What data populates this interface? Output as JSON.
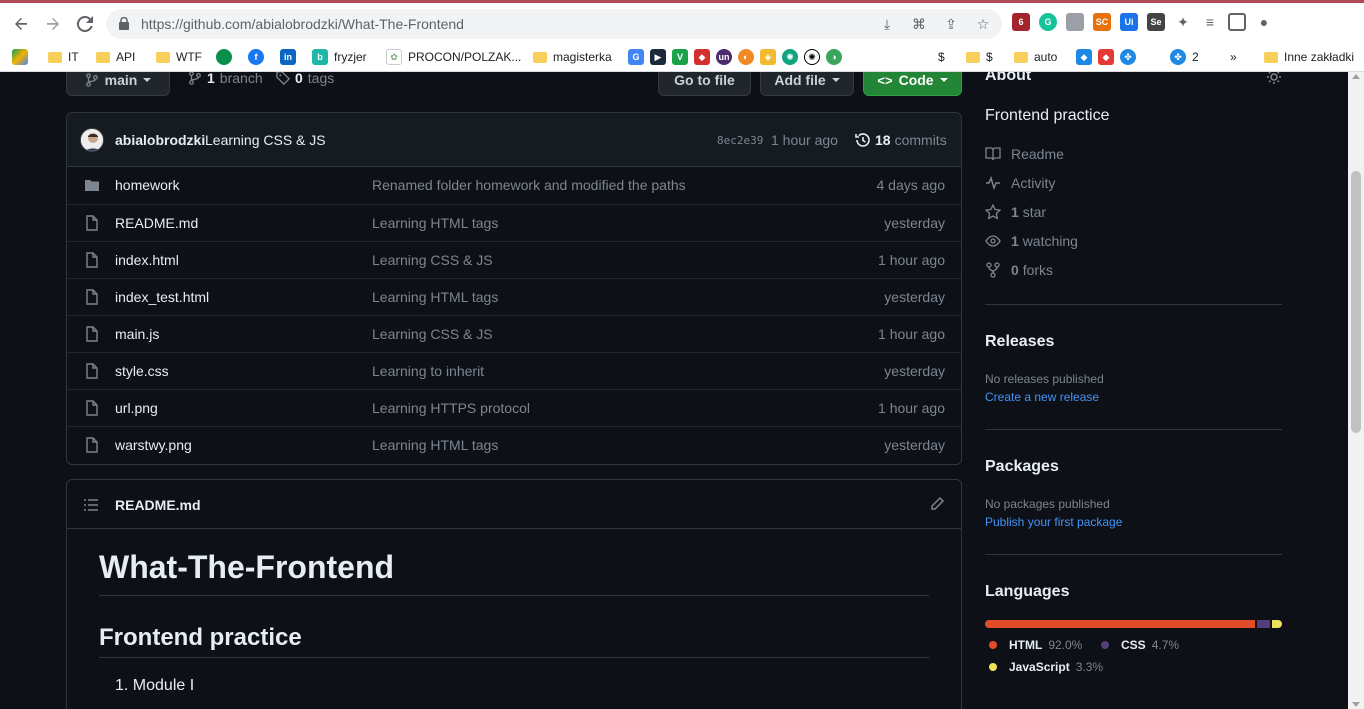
{
  "browser": {
    "url_domain": "https://github.com",
    "url_path": "/abialobrodzki/What-The-Frontend"
  },
  "bookmarks": [
    {
      "label": "",
      "icon": "drive-icon"
    },
    {
      "label": "IT",
      "icon": "folder-icon"
    },
    {
      "label": "API",
      "icon": "folder-icon"
    },
    {
      "label": "WTF",
      "icon": "folder-icon"
    },
    {
      "label": "",
      "icon": "cloud-icon"
    },
    {
      "label": "",
      "icon": "facebook-icon"
    },
    {
      "label": "",
      "icon": "linkedin-icon"
    },
    {
      "label": "fryzjer",
      "icon": "booksy-icon"
    },
    {
      "label": "PROCON/POLZAK...",
      "icon": "procon-icon"
    },
    {
      "label": "magisterka",
      "icon": "folder-icon"
    },
    {
      "label": "$",
      "icon": "folder-icon"
    },
    {
      "label": "$",
      "icon": "folder-icon"
    },
    {
      "label": "auto",
      "icon": "folder-icon"
    },
    {
      "label": "2",
      "icon": "app-icon"
    },
    {
      "label": "Inne zakładki",
      "icon": "folder-icon"
    }
  ],
  "repo": {
    "branch_name": "main",
    "branch_count": "1",
    "branch_label": "branch",
    "tag_count": "0",
    "tag_label": "tags",
    "go_to_file": "Go to file",
    "add_file": "Add file",
    "code": "Code",
    "commit": {
      "author": "abialobrodzki",
      "message": "Learning CSS & JS",
      "sha": "8ec2e39",
      "time": "1 hour ago",
      "count": "18",
      "count_label": "commits"
    },
    "files": [
      {
        "name": "homework",
        "type": "folder",
        "message": "Renamed folder homework and modified the paths",
        "time": "4 days ago"
      },
      {
        "name": "README.md",
        "type": "file",
        "message": "Learning HTML tags",
        "time": "yesterday"
      },
      {
        "name": "index.html",
        "type": "file",
        "message": "Learning CSS & JS",
        "time": "1 hour ago"
      },
      {
        "name": "index_test.html",
        "type": "file",
        "message": "Learning HTML tags",
        "time": "yesterday"
      },
      {
        "name": "main.js",
        "type": "file",
        "message": "Learning CSS & JS",
        "time": "1 hour ago"
      },
      {
        "name": "style.css",
        "type": "file",
        "message": "Learning to inherit",
        "time": "yesterday"
      },
      {
        "name": "url.png",
        "type": "file",
        "message": "Learning HTTPS protocol",
        "time": "1 hour ago"
      },
      {
        "name": "warstwy.png",
        "type": "file",
        "message": "Learning HTML tags",
        "time": "yesterday"
      }
    ]
  },
  "readme": {
    "filename": "README.md",
    "h1": "What-The-Frontend",
    "h2": "Frontend practice",
    "list_item": "1. Module I"
  },
  "sidebar": {
    "about_title": "About",
    "description": "Frontend practice",
    "readme": "Readme",
    "activity": "Activity",
    "stars_count": "1",
    "stars_label": "star",
    "watching_count": "1",
    "watching_label": "watching",
    "forks_count": "0",
    "forks_label": "forks",
    "releases_title": "Releases",
    "releases_text": "No releases published",
    "releases_link": "Create a new release",
    "packages_title": "Packages",
    "packages_text": "No packages published",
    "packages_link": "Publish your first package",
    "languages_title": "Languages",
    "languages": [
      {
        "name": "HTML",
        "percent": "92.0%",
        "value": 92.0,
        "color": "#e34c26"
      },
      {
        "name": "CSS",
        "percent": "4.7%",
        "value": 4.7,
        "color": "#563d7c"
      },
      {
        "name": "JavaScript",
        "percent": "3.3%",
        "value": 3.3,
        "color": "#f1e05a"
      }
    ]
  }
}
